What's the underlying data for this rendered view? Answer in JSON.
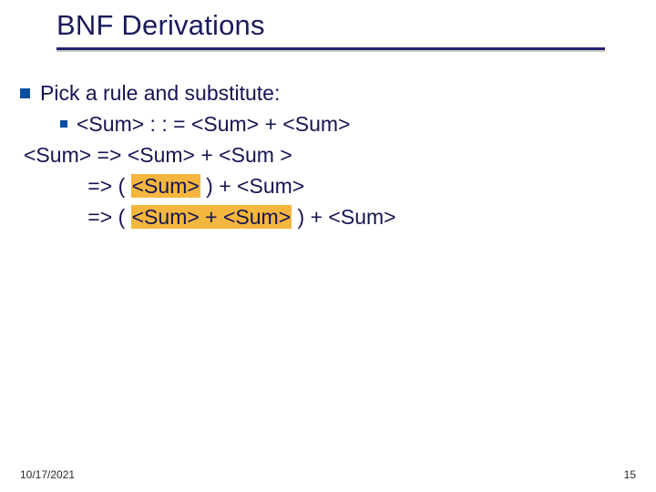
{
  "title": "BNF Derivations",
  "bullet1": "Pick a rule and substitute:",
  "rule": "<Sum> : : = <Sum> + <Sum>",
  "deriv": {
    "l1_left": "<Sum> ",
    "l1_arrow": "=> ",
    "l1_right": "<Sum> + <Sum >",
    "indent": "           ",
    "l2_arrow": "=> ",
    "l2_a": "( ",
    "l2_hl": "<Sum>",
    "l2_b": " ) + <Sum>",
    "l3_arrow": "=> ",
    "l3_a": "( ",
    "l3_hl": "<Sum> + <Sum>",
    "l3_b": " ) + <Sum>"
  },
  "footer": {
    "date": "10/17/2021",
    "page": "15"
  }
}
